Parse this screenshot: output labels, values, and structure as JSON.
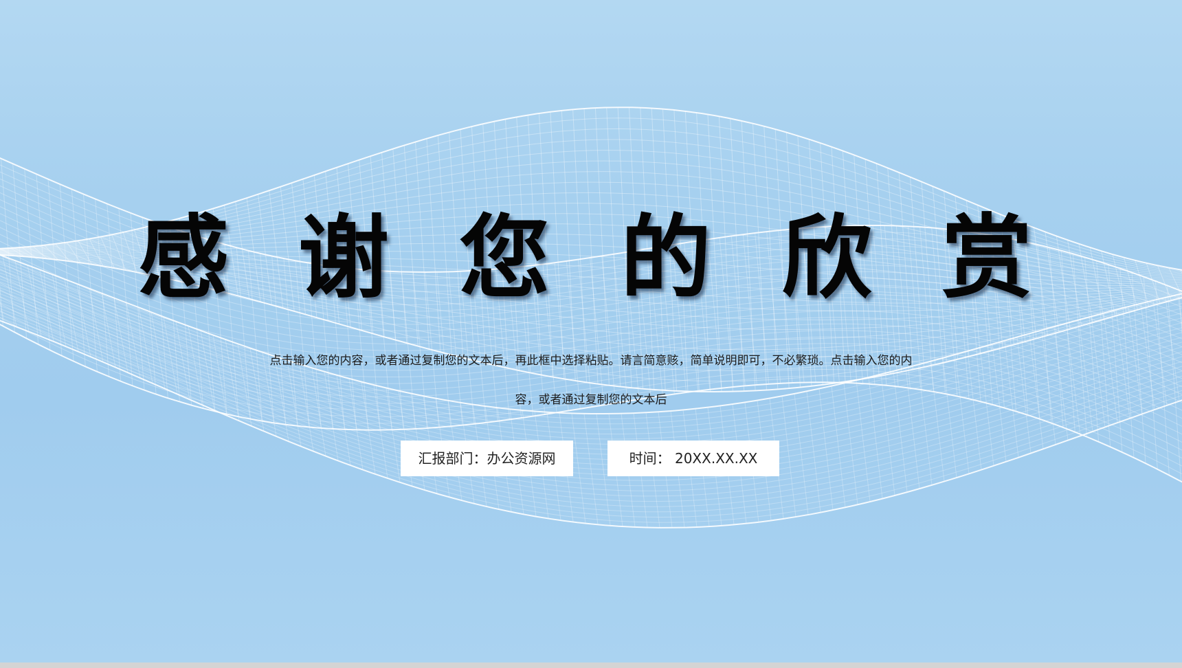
{
  "title": {
    "chars": [
      "感",
      "谢",
      "您",
      "的",
      "欣",
      "赏"
    ]
  },
  "description": {
    "line1": "点击输入您的内容，或者通过复制您的文本后，再此框中选择粘贴。请言简意赅，简单说明即可，不必繁琐。点击输入您的内",
    "line2": "容，或者通过复制您的文本后"
  },
  "info": {
    "department": "汇报部门：办公资源网",
    "time": "时间：  20XX.XX.XX"
  },
  "colors": {
    "background": "#a6d0ef",
    "wave": "#ffffff",
    "title": "#050505"
  }
}
